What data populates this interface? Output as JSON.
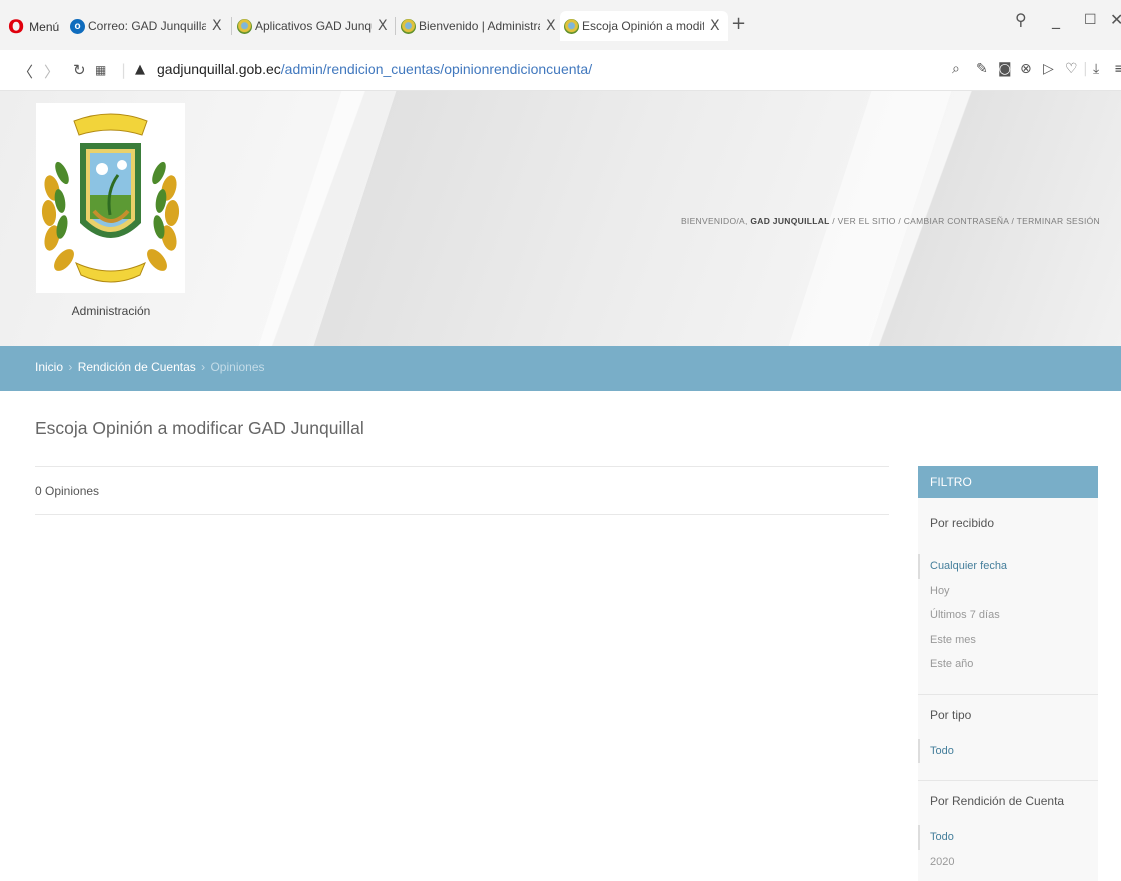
{
  "browser": {
    "menu_label": "Menú",
    "tabs": [
      {
        "title": "Correo: GAD Junquillal - O",
        "icon": "outlook-icon",
        "active": false
      },
      {
        "title": "Aplicativos GAD Junquillal",
        "icon": "seal-favicon",
        "active": false
      },
      {
        "title": "Bienvenido | Administrado",
        "icon": "seal-favicon",
        "active": false
      },
      {
        "title": "Escoja Opinión a modificar",
        "icon": "seal-favicon",
        "active": true
      }
    ],
    "tab_close": "X",
    "new_tab": "+",
    "url_host": "gadjunquillal.gob.ec",
    "url_path": "/admin/rendicion_cuentas/opinionrendicioncuenta/"
  },
  "header": {
    "admin_label": "Administración",
    "welcome": "BIENVENIDO/A,",
    "user": "GAD JUNQUILLAL",
    "view_site": "VER EL SITIO",
    "change_password": "CAMBIAR CONTRASEÑA",
    "logout": "TERMINAR SESIÓN",
    "separator": " / "
  },
  "breadcrumbs": {
    "home": "Inicio",
    "section": "Rendición de Cuentas",
    "current": "Opiniones",
    "separator": "›"
  },
  "content": {
    "title": "Escoja Opinión a modificar GAD Junquillal",
    "result_count": "0 Opiniones"
  },
  "filter": {
    "heading": "FILTRO",
    "groups": [
      {
        "title": "Por recibido",
        "items": [
          "Cualquier fecha",
          "Hoy",
          "Últimos 7 días",
          "Este mes",
          "Este año"
        ]
      },
      {
        "title": "Por tipo",
        "items": [
          "Todo"
        ]
      },
      {
        "title": "Por Rendición de Cuenta",
        "items": [
          "Todo",
          "2020"
        ]
      }
    ]
  },
  "colors": {
    "accent": "#79aec8",
    "link": "#447e9b",
    "opera_red": "#e0000d"
  }
}
